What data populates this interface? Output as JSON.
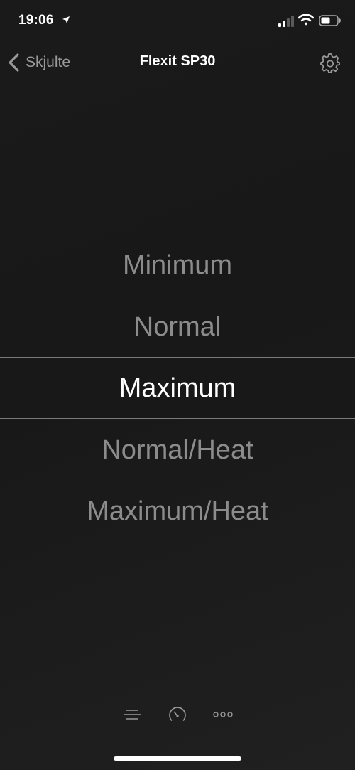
{
  "status_bar": {
    "time": "19:06",
    "icons": [
      "location-arrow-icon",
      "cellular-signal-icon",
      "wifi-icon",
      "battery-icon"
    ]
  },
  "nav": {
    "back_label": "Skjulte",
    "title": "Flexit SP30",
    "settings_icon": "gear-icon"
  },
  "picker": {
    "options": [
      "Minimum",
      "Normal",
      "Maximum",
      "Normal/Heat",
      "Maximum/Heat"
    ],
    "selected": "Maximum"
  },
  "tab_bar": {
    "tabs": [
      "lines-icon",
      "speedometer-icon",
      "more-dots-icon"
    ]
  },
  "colors": {
    "background": "#1b1b1b",
    "text_selected": "#ffffff",
    "text_unselected": "#8c8c8c",
    "nav_secondary": "#9a9a9a"
  }
}
